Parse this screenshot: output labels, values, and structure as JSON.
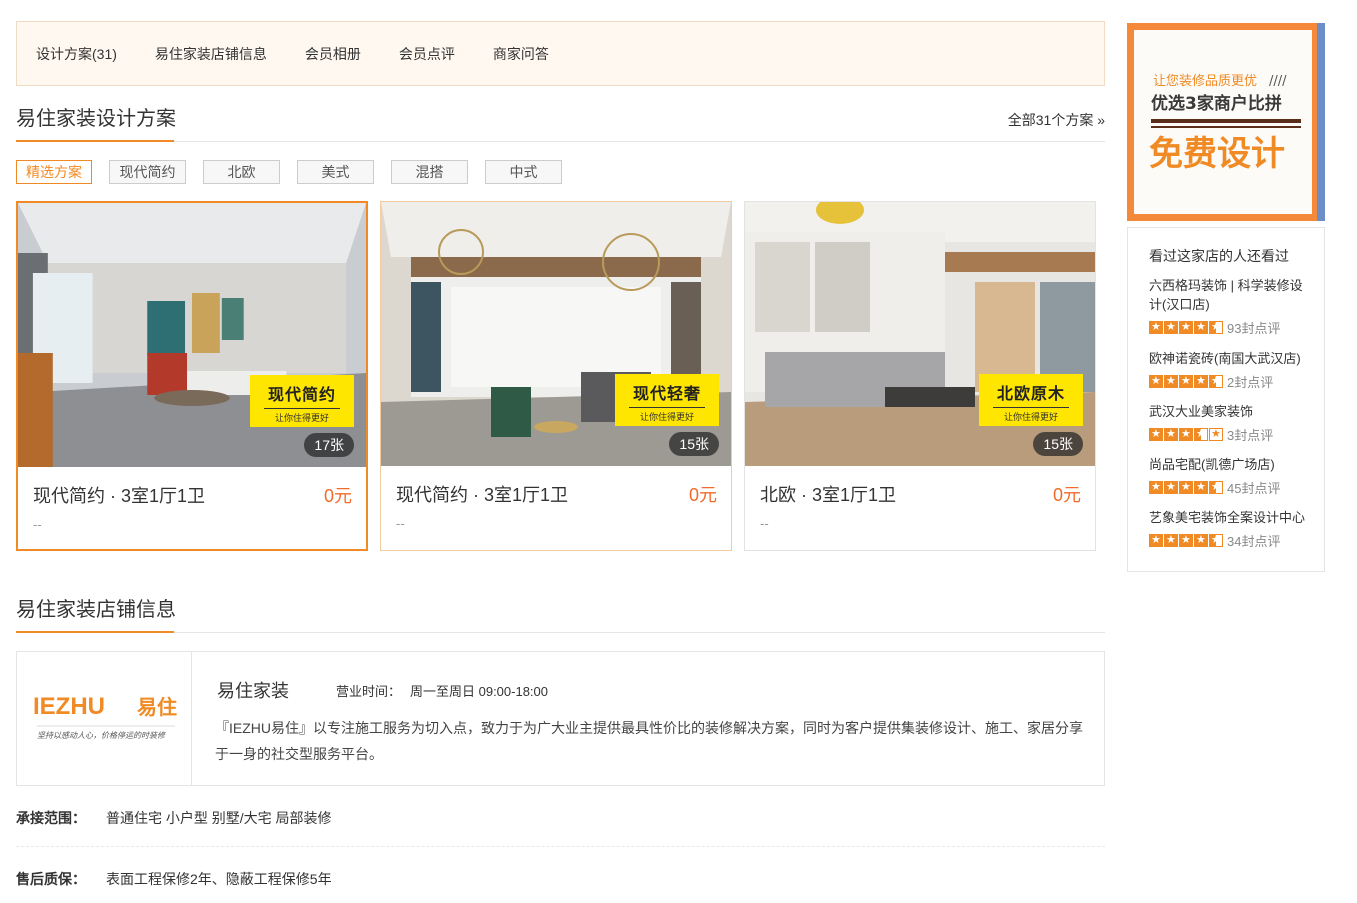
{
  "nav": {
    "items": [
      "设计方案(31)",
      "易住家装店铺信息",
      "会员相册",
      "会员点评",
      "商家问答"
    ]
  },
  "designs": {
    "title": "易住家装设计方案",
    "more": "全部31个方案 »",
    "tags": [
      "精选方案",
      "现代简约",
      "北欧",
      "美式",
      "混搭",
      "中式"
    ],
    "active_tag": "精选方案",
    "cards": [
      {
        "title": "现代简约 · 3室1厅1卫",
        "price": "0元",
        "sub": "--",
        "badge": "现代简约",
        "badge_sub": "让你住得更好",
        "count": "17张"
      },
      {
        "title": "现代简约 · 3室1厅1卫",
        "price": "0元",
        "sub": "--",
        "badge": "现代轻奢",
        "badge_sub": "让你住得更好",
        "count": "15张"
      },
      {
        "title": "北欧 · 3室1厅1卫",
        "price": "0元",
        "sub": "--",
        "badge": "北欧原木",
        "badge_sub": "让你住得更好",
        "count": "15张"
      }
    ]
  },
  "store": {
    "section_title": "易住家装店铺信息",
    "logo_text": "IEZHU",
    "logo_cn": "易住",
    "logo_slogan": "坚持以感动人心，价格停运的时装修",
    "name": "易住家装",
    "hours_label": "营业时间：",
    "hours": "周一至周日 09:00-18:00",
    "description": "『IEZHU易住』以专注施工服务为切入点，致力于为广大业主提供最具性价比的装修解决方案，同时为客户提供集装修设计、施工、家居分享于一身的社交型服务平台。",
    "scope_label": "承接范围：",
    "scope": "普通住宅 小户型 别墅/大宅 局部装修",
    "warranty_label": "售后质保：",
    "warranty": "表面工程保修2年、隐蔽工程保修5年"
  },
  "ad": {
    "line1": "让您装修品质更优",
    "line2": "优选3家商户比拼",
    "line3": "免费设计"
  },
  "sidebar": {
    "title": "看过这家店的人还看过",
    "items": [
      {
        "name": "六西格玛装饰 | 科学装修设计(汉口店)",
        "rating": 4.5,
        "reviews": "93封点评"
      },
      {
        "name": "欧神诺瓷砖(南国大武汉店)",
        "rating": 4.5,
        "reviews": "2封点评"
      },
      {
        "name": "武汉大业美家装饰",
        "rating": 3.5,
        "reviews": "3封点评"
      },
      {
        "name": "尚品宅配(凯德广场店)",
        "rating": 4.5,
        "reviews": "45封点评"
      },
      {
        "name": "艺象美宅装饰全案设计中心",
        "rating": 4.5,
        "reviews": "34封点评"
      }
    ]
  },
  "colors": {
    "accent": "#f08a24",
    "price": "#f26b2a",
    "badge": "#ffe600"
  }
}
